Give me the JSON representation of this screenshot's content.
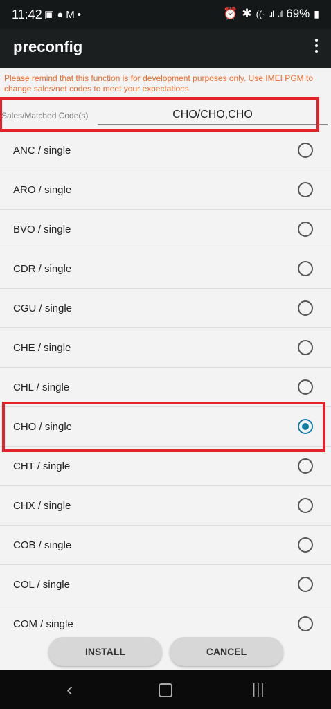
{
  "status": {
    "time": "11:42",
    "battery": "69%"
  },
  "app": {
    "title": "preconfig"
  },
  "warning": "Please remind that this function is for development purposes only. Use IMEI PGM to change sales/net codes to meet your expectations",
  "code_field": {
    "label": "Sales/Matched Code(s)",
    "value": "CHO/CHO,CHO"
  },
  "items": [
    {
      "label": "ANC / single"
    },
    {
      "label": "ARO / single"
    },
    {
      "label": "BVO / single"
    },
    {
      "label": "CDR / single"
    },
    {
      "label": "CGU / single"
    },
    {
      "label": "CHE / single"
    },
    {
      "label": "CHL / single"
    },
    {
      "label": "CHO / single"
    },
    {
      "label": "CHT / single"
    },
    {
      "label": "CHX / single"
    },
    {
      "label": "COB / single"
    },
    {
      "label": "COL / single"
    },
    {
      "label": "COM / single"
    }
  ],
  "selected_index": 7,
  "buttons": {
    "install": "INSTALL",
    "cancel": "CANCEL"
  },
  "colors": {
    "accent": "#127ea6",
    "warning": "#ee6a2c",
    "highlight": "#e32128"
  }
}
